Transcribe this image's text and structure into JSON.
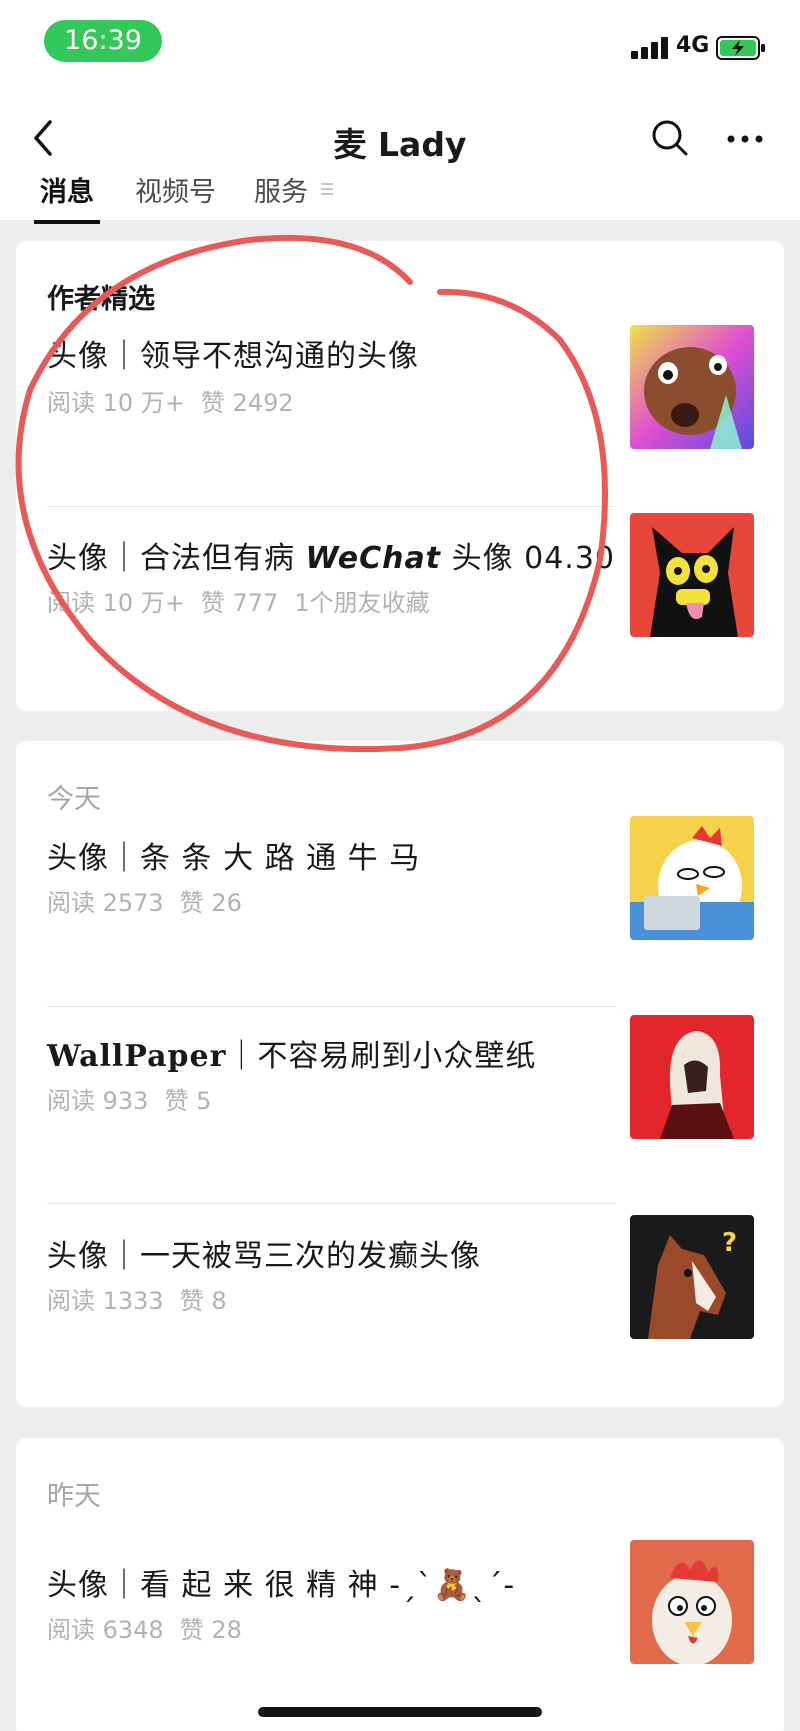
{
  "status": {
    "time": "16:39",
    "network": "4G"
  },
  "nav": {
    "title": "麦 Lady",
    "tabs": [
      "消息",
      "视频号",
      "服务"
    ]
  },
  "featured": {
    "heading": "作者精选",
    "items": [
      {
        "title": "头像｜领导不想沟通的头像",
        "reads": "阅读 10 万+",
        "likes": "赞 2492",
        "extra": ""
      },
      {
        "title_prefix": "头像｜合法但有病 ",
        "title_brand": "WeChat",
        "title_suffix": " 头像 04.30",
        "reads": "阅读 10 万+",
        "likes": "赞 777",
        "extra": "1个朋友收藏"
      }
    ]
  },
  "today": {
    "heading": "今天",
    "items": [
      {
        "title": "头像｜条 条 大 路 通 牛 马",
        "reads": "阅读 2573",
        "likes": "赞 26"
      },
      {
        "title_brand": "WallPaper",
        "title_suffix": "｜不容易刷到小众壁纸",
        "reads": "阅读 933",
        "likes": "赞 5"
      },
      {
        "title": "头像｜一天被骂三次的发癫头像",
        "reads": "阅读 1333",
        "likes": "赞 8"
      }
    ]
  },
  "yesterday": {
    "heading": "昨天",
    "items": [
      {
        "title": "头像｜看 起 来 很 精 神 -ˏˋ🧸ˎˊ-",
        "reads": "阅读 6348",
        "likes": "赞 28"
      }
    ]
  }
}
